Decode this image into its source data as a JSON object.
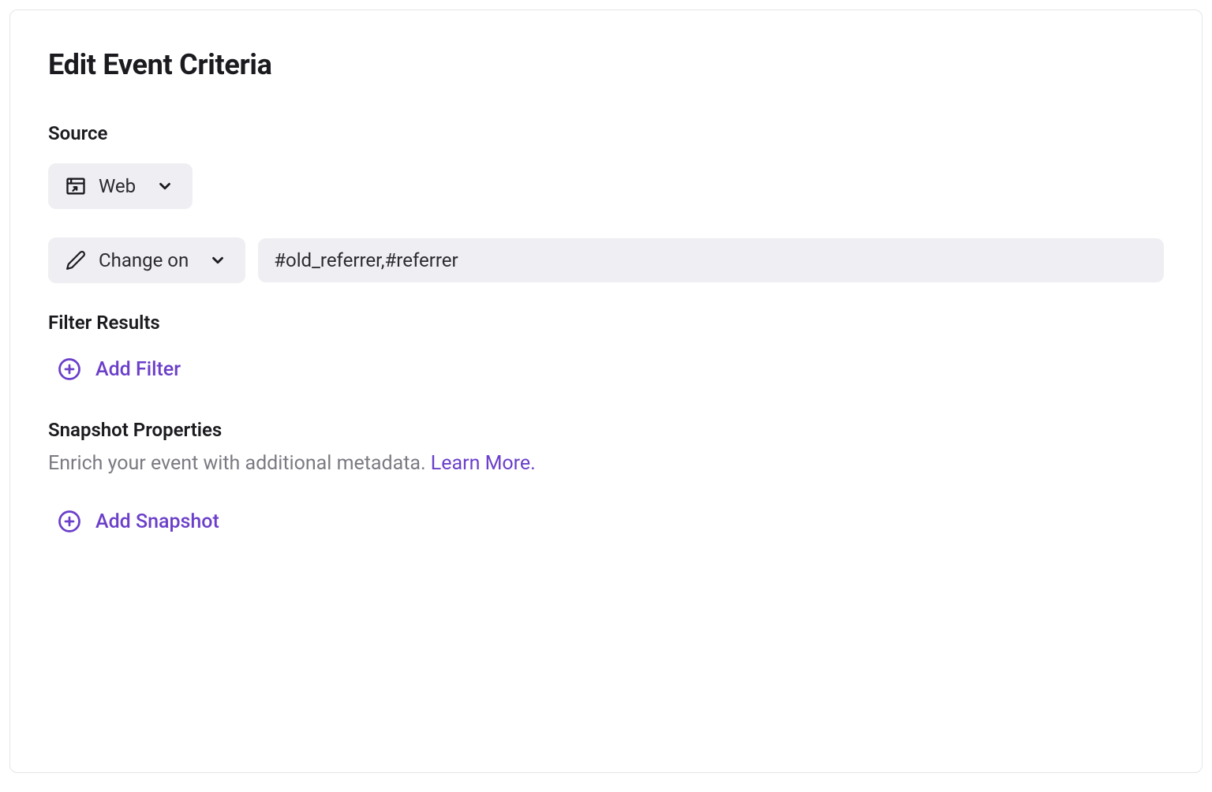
{
  "title": "Edit Event Criteria",
  "source": {
    "label": "Source",
    "selector": {
      "label": "Web"
    }
  },
  "criteria": {
    "type_selector": {
      "label": "Change on"
    },
    "value": "#old_referrer,#referrer"
  },
  "filter": {
    "heading": "Filter Results",
    "add_label": "Add Filter"
  },
  "snapshot": {
    "heading": "Snapshot Properties",
    "description": "Enrich your event with additional metadata. ",
    "learn_more": "Learn More.",
    "add_label": "Add Snapshot"
  }
}
